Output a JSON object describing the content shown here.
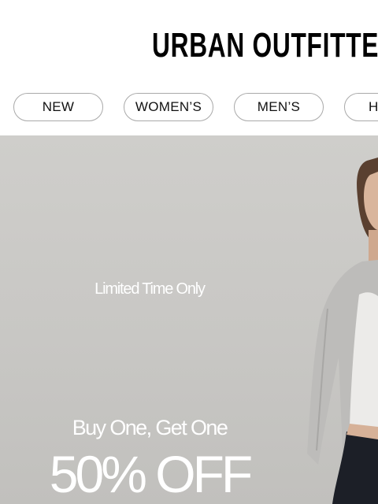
{
  "header": {
    "logo_text": "URBAN OUTFITTERS"
  },
  "nav": {
    "items": [
      {
        "label": "NEW"
      },
      {
        "label": "WOMEN’S"
      },
      {
        "label": "MEN’S"
      },
      {
        "label": "H"
      }
    ]
  },
  "hero": {
    "eyebrow": "Limited Time Only",
    "headline": "Buy One, Get One",
    "offer": "50% OFF",
    "image_icon": "model-photo"
  },
  "colors": {
    "background": "#ffffff",
    "hero_background": "#cbcac7",
    "hero_text": "#ffffff",
    "pill_border": "#a9a9a9",
    "logo": "#000000"
  }
}
